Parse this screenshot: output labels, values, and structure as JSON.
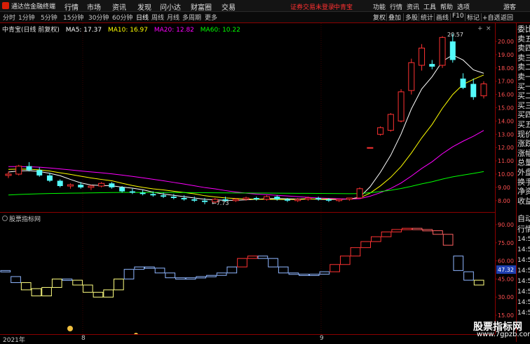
{
  "app": {
    "name": "通达信金融终端",
    "menu": [
      "行情",
      "市场",
      "资讯",
      "发现",
      "问小达",
      "财富圈",
      "交易"
    ],
    "login_notice": "证券交易未登录",
    "stock": "中青宝",
    "right_menu": [
      "功能",
      "行情",
      "资讯",
      "工具",
      "帮助",
      "选项"
    ],
    "guest": "游客"
  },
  "periods": [
    "分时",
    "1分钟",
    "5分钟",
    "15分钟",
    "30分钟",
    "60分钟",
    "日线",
    "周线",
    "月线",
    "多周期",
    "更多"
  ],
  "active_period": "日线",
  "tools": [
    "复权",
    "叠加",
    "多股",
    "统计",
    "画线",
    "F10",
    "标记",
    "+自选",
    "返回"
  ],
  "chart_header": {
    "title": "中青宝(日线 前复权)",
    "ma5": "MA5: 17.37",
    "ma10": "MA10: 16.97",
    "ma20": "MA20: 12.82",
    "ma60": "MA60: 10.22"
  },
  "colors": {
    "up": "#ff3232",
    "down": "#54fcfc",
    "ma5": "#ffffff",
    "ma10": "#ffff00",
    "ma20": "#ff00ff",
    "ma60": "#00ff00",
    "indicator_low": "#ffff80",
    "indicator_mid": "#8fb6ff"
  },
  "price_axis": [
    "20.00",
    "19.00",
    "18.00",
    "17.00",
    "16.00",
    "15.00",
    "14.00",
    "13.00",
    "12.00",
    "11.00",
    "10.00",
    "9.00",
    "8.00"
  ],
  "annotations": {
    "high": "20.57",
    "low": "7.73"
  },
  "indicator": {
    "title": "股票指标网",
    "axis": [
      "90.00",
      "75.00",
      "60.00",
      "45.00",
      "30.00",
      "15.00"
    ],
    "last_value": "47.32"
  },
  "bottom_axis": {
    "year": "2021年",
    "m8": "8",
    "m9": "9"
  },
  "side_panel": [
    "委比",
    "卖五",
    "卖四",
    "卖三",
    "卖二",
    "卖一",
    "买一",
    "买二",
    "买三",
    "买四",
    "买五",
    "现价",
    "涨跌",
    "涨幅",
    "总量",
    "外盘",
    "换手",
    "净资",
    "收益"
  ],
  "side_panel2": [
    "自动",
    "行情",
    "14:50",
    "14:50",
    "14:50",
    "14:50",
    "14:50",
    "14:50",
    "14:50",
    "14:50"
  ],
  "watermark": {
    "title": "股票指标网",
    "url": "www.7gpzb.com"
  },
  "candles": [
    [
      9.9,
      10.2,
      9.7,
      10.0
    ],
    [
      10.0,
      10.7,
      9.9,
      10.6
    ],
    [
      10.6,
      10.9,
      10.2,
      10.3
    ],
    [
      10.3,
      10.5,
      9.8,
      9.9
    ],
    [
      9.9,
      10.1,
      9.4,
      9.5
    ],
    [
      9.5,
      9.6,
      9.0,
      9.1
    ],
    [
      9.1,
      9.3,
      8.9,
      9.2
    ],
    [
      9.2,
      9.4,
      8.9,
      9.0
    ],
    [
      9.0,
      9.2,
      8.8,
      9.1
    ],
    [
      9.1,
      9.4,
      9.0,
      9.3
    ],
    [
      9.3,
      9.4,
      8.9,
      9.0
    ],
    [
      9.0,
      9.1,
      8.6,
      8.7
    ],
    [
      8.7,
      8.9,
      8.5,
      8.6
    ],
    [
      8.6,
      8.8,
      8.4,
      8.5
    ],
    [
      8.5,
      8.7,
      8.3,
      8.4
    ],
    [
      8.4,
      8.6,
      8.2,
      8.3
    ],
    [
      8.3,
      8.5,
      8.1,
      8.2
    ],
    [
      8.2,
      8.4,
      8.0,
      8.1
    ],
    [
      8.1,
      8.3,
      7.9,
      8.0
    ],
    [
      8.0,
      8.2,
      7.73,
      7.9
    ],
    [
      7.9,
      8.2,
      7.8,
      8.1
    ],
    [
      8.1,
      8.3,
      7.9,
      8.0
    ],
    [
      8.0,
      8.2,
      7.9,
      8.1
    ],
    [
      8.1,
      8.3,
      8.0,
      8.2
    ],
    [
      8.2,
      8.3,
      8.0,
      8.1
    ],
    [
      8.1,
      8.4,
      8.0,
      8.3
    ],
    [
      8.3,
      8.4,
      8.0,
      8.1
    ],
    [
      8.1,
      8.2,
      7.9,
      8.0
    ],
    [
      8.0,
      8.2,
      7.9,
      8.1
    ],
    [
      8.1,
      8.3,
      8.0,
      8.2
    ],
    [
      8.2,
      8.3,
      8.0,
      8.1
    ],
    [
      8.1,
      8.2,
      7.9,
      8.0
    ],
    [
      8.0,
      8.1,
      7.9,
      8.1
    ],
    [
      8.1,
      8.2,
      8.0,
      8.2
    ],
    [
      8.2,
      9.0,
      8.2,
      8.9
    ],
    [
      12.0,
      12.0,
      12.0,
      12.0
    ],
    [
      13.0,
      13.6,
      12.9,
      13.5
    ],
    [
      13.3,
      14.6,
      13.2,
      14.5
    ],
    [
      14.0,
      16.4,
      13.9,
      16.2
    ],
    [
      16.3,
      18.7,
      16.0,
      18.4
    ],
    [
      18.2,
      19.8,
      17.8,
      19.5
    ],
    [
      18.3,
      18.6,
      17.9,
      18.1
    ],
    [
      18.2,
      20.4,
      18.0,
      20.3
    ],
    [
      20.0,
      20.57,
      18.4,
      18.6
    ],
    [
      17.2,
      17.6,
      16.4,
      16.5
    ],
    [
      16.8,
      17.2,
      15.6,
      15.8
    ],
    [
      15.9,
      17.0,
      15.7,
      16.8
    ]
  ],
  "ind_boxes": [
    [
      52,
      51
    ],
    [
      47,
      42
    ],
    [
      42,
      36
    ],
    [
      37,
      31
    ],
    [
      31,
      38
    ],
    [
      38,
      45
    ],
    [
      45,
      44
    ],
    [
      44,
      40
    ],
    [
      40,
      34
    ],
    [
      34,
      30
    ],
    [
      30,
      36
    ],
    [
      36,
      45
    ],
    [
      45,
      53
    ],
    [
      53,
      55
    ],
    [
      55,
      54
    ],
    [
      54,
      50
    ],
    [
      50,
      46
    ],
    [
      46,
      45
    ],
    [
      45,
      46
    ],
    [
      46,
      47
    ],
    [
      47,
      48
    ],
    [
      48,
      50
    ],
    [
      50,
      55
    ],
    [
      55,
      62
    ],
    [
      62,
      64
    ],
    [
      64,
      62
    ],
    [
      62,
      55
    ],
    [
      55,
      50
    ],
    [
      50,
      49
    ],
    [
      49,
      48
    ],
    [
      48,
      49
    ],
    [
      49,
      51
    ],
    [
      51,
      57
    ],
    [
      57,
      64
    ],
    [
      64,
      71
    ],
    [
      71,
      76
    ],
    [
      76,
      80
    ],
    [
      80,
      84
    ],
    [
      84,
      86
    ],
    [
      86,
      87
    ],
    [
      87,
      86
    ],
    [
      86,
      85
    ],
    [
      85,
      82
    ],
    [
      82,
      73
    ],
    [
      64,
      52
    ],
    [
      51,
      44
    ],
    [
      44,
      40
    ]
  ]
}
